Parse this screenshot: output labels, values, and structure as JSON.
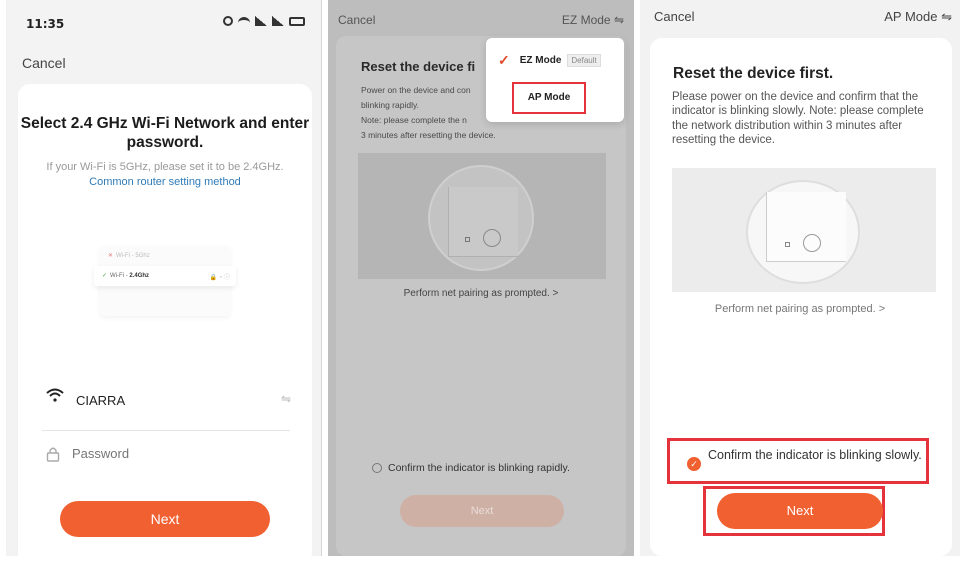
{
  "panel1": {
    "status_time": "11:35",
    "cancel": "Cancel",
    "title": "Select 2.4 GHz Wi-Fi Network and enter password.",
    "subtitle": "If your Wi-Fi is 5GHz, please set it to be 2.4GHz.",
    "link": "Common router setting method",
    "illus_row1": "Wi-Fi - 5Ghz",
    "illus_row2_prefix": "Wi-Fi - ",
    "illus_row2_bold": "2.4Ghz",
    "ssid": "CIARRA",
    "password_placeholder": "Password",
    "next": "Next"
  },
  "panel2": {
    "cancel": "Cancel",
    "mode": "EZ Mode",
    "menu": {
      "ez_mode": "EZ Mode",
      "default_badge": "Default",
      "ap_mode": "AP Mode"
    },
    "title": "Reset the device fi",
    "body_lines": [
      "Power on the device and con",
      "blinking rapidly.",
      "Note: please complete the n",
      "3 minutes after resetting the device."
    ],
    "prompt": "Perform net pairing as prompted. >",
    "confirm": "Confirm the indicator is blinking rapidly.",
    "next": "Next"
  },
  "panel3": {
    "cancel": "Cancel",
    "mode": "AP Mode",
    "title": "Reset the device first.",
    "body": "Please power on the device and confirm that the indicator is blinking slowly. Note: please complete the network distribution within 3 minutes after resetting the device.",
    "prompt": "Perform net pairing as prompted. >",
    "confirm": "Confirm the indicator is blinking slowly.",
    "next": "Next"
  },
  "colors": {
    "accent": "#f06030",
    "highlight": "#e5333b",
    "link": "#2f7bb8"
  },
  "icons": [
    "alarm-icon",
    "wifi-status-icon",
    "signal-icon",
    "battery-icon",
    "wifi-icon",
    "swap-icon",
    "lock-icon",
    "check-icon",
    "power-icon"
  ]
}
